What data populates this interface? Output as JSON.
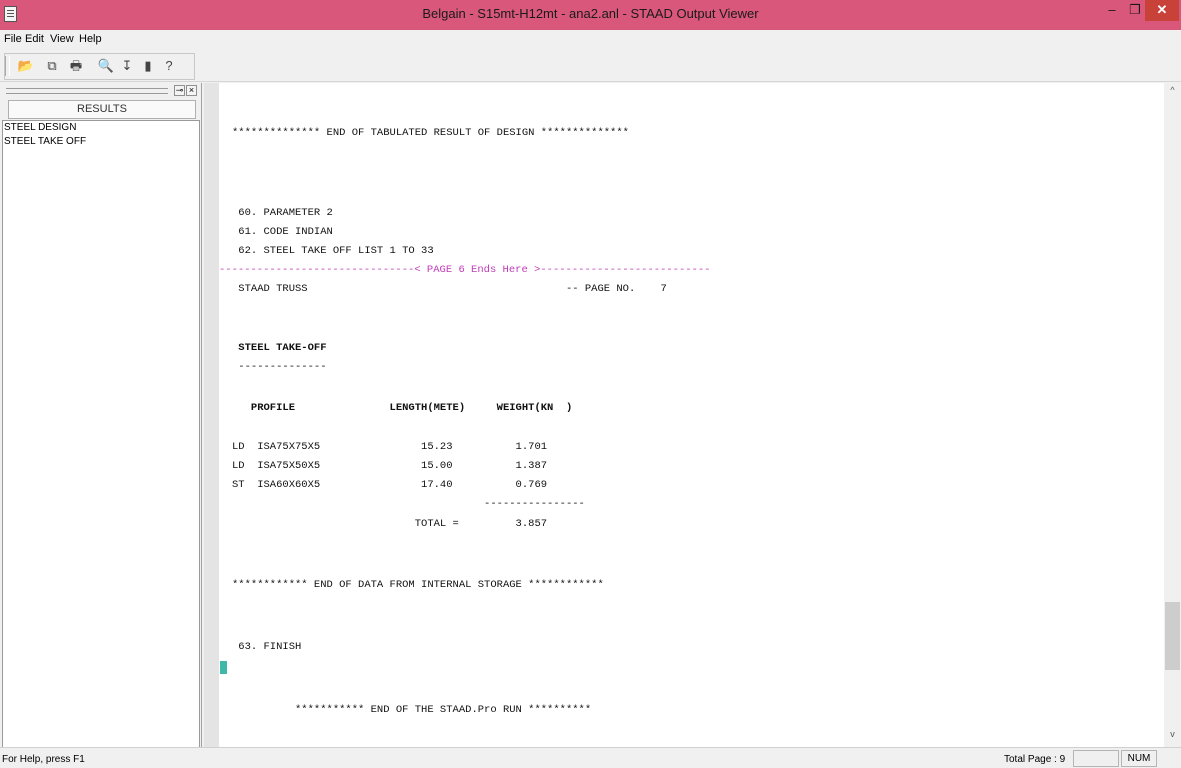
{
  "window": {
    "title": "Belgain - S15mt-H12mt - ana2.anl - STAAD Output Viewer",
    "minimize_glyph": "–",
    "maximize_glyph": "❐",
    "close_glyph": "✕"
  },
  "menu": [
    "File",
    "Edit",
    "View",
    "Help"
  ],
  "toolbar": {
    "buttons": [
      {
        "icon": "open-folder-icon",
        "glyph": "📂"
      },
      {
        "icon": "copy-icon",
        "glyph": "⧉"
      },
      {
        "icon": "print-icon",
        "glyph": "🖶"
      },
      {
        "icon": "find-binoculars-icon",
        "glyph": "🔍"
      },
      {
        "icon": "goto-page-icon",
        "glyph": "↧"
      },
      {
        "icon": "stop-icon",
        "glyph": "▮"
      },
      {
        "icon": "context-help-icon",
        "glyph": "?"
      }
    ]
  },
  "left_pane": {
    "header": "RESULTS",
    "items": [
      "STEEL DESIGN",
      "STEEL TAKE OFF"
    ],
    "pin_glyph": "⊸",
    "close_glyph": "×"
  },
  "output": {
    "lines": [
      "************** END OF TABULATED RESULT OF DESIGN **************",
      " 60. PARAMETER 2",
      " 61. CODE INDIAN",
      " 62. STEEL TAKE OFF LIST 1 TO 33",
      "-------------------------------< PAGE 6 Ends Here >---------------------------",
      " STAAD TRUSS                                         -- PAGE NO.    7",
      " STEEL TAKE-OFF",
      " --------------",
      "   PROFILE               LENGTH(METE)     WEIGHT(KN  )",
      "LD  ISA75X75X5                15.23          1.701",
      "LD  ISA75X50X5                15.00          1.387",
      "ST  ISA60X60X5                17.40          0.769",
      "                                        ----------------",
      "                             TOTAL =         3.857",
      "************ END OF DATA FROM INTERNAL STORAGE ************",
      " 63. FINISH",
      "          *********** END OF THE STAAD.Pro RUN **********"
    ]
  },
  "status": {
    "help": "For Help, press F1",
    "total_page_label": "Total Page :  9",
    "num": "NUM"
  },
  "colors": {
    "titlebar": "#d9577a",
    "close_button": "#c9423a",
    "page_break_text": "#c03bb8",
    "caret": "#3fb8a7"
  }
}
